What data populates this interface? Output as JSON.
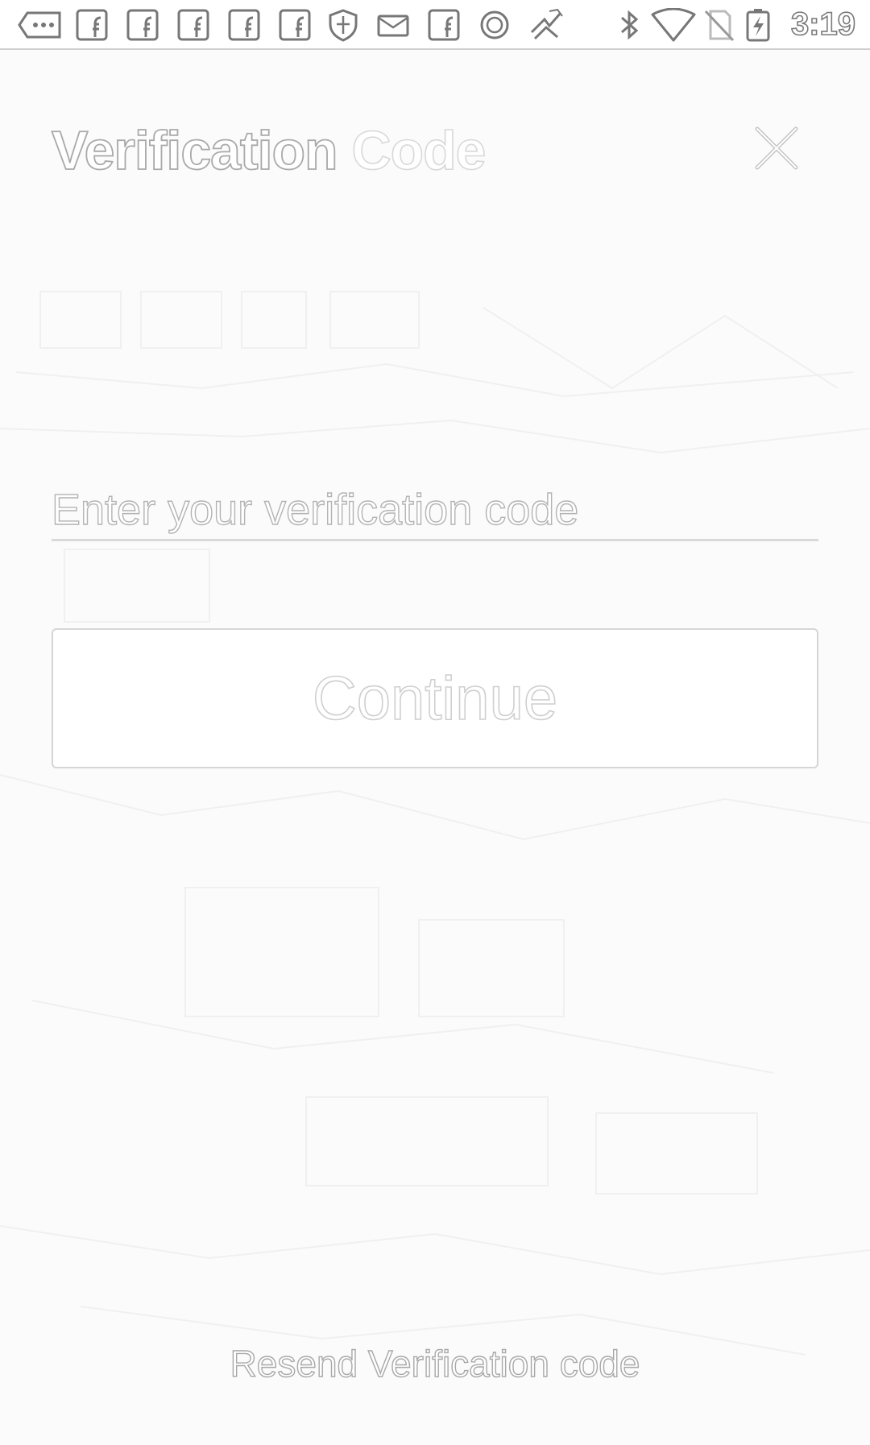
{
  "status_bar": {
    "time": "3:19",
    "left_icons": [
      "more-dots-icon",
      "facebook-icon",
      "facebook-icon",
      "facebook-icon",
      "facebook-icon",
      "facebook-icon",
      "shield-icon",
      "mail-icon",
      "facebook-icon",
      "circle-icon",
      "fan-icon"
    ],
    "right_icons": [
      "bluetooth-icon",
      "wifi-icon",
      "no-sim-icon",
      "battery-charging-icon"
    ]
  },
  "header": {
    "title_part1": "Verification",
    "title_part2": "Code",
    "close_icon": "close-icon"
  },
  "form": {
    "code_placeholder": "Enter your verification code",
    "code_value": "",
    "continue_label": "Continue"
  },
  "footer": {
    "resend_label": "Resend Verification code"
  },
  "colors": {
    "background": "#fbfbfb",
    "outline": "#b8b8b8",
    "divider": "#d9d9d9"
  }
}
